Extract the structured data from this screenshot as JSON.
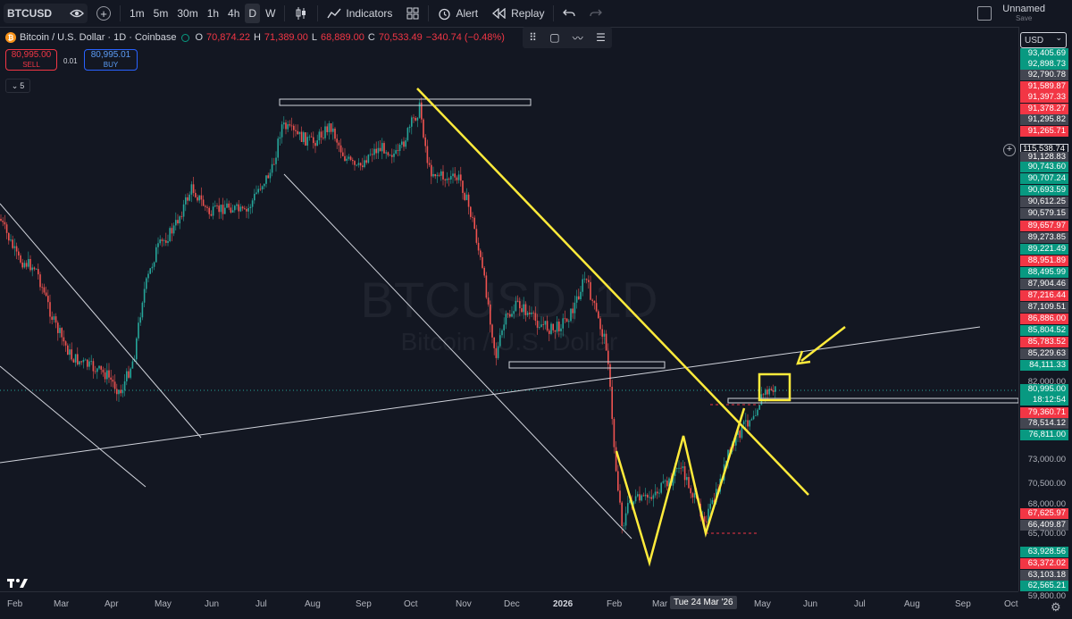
{
  "toolbar": {
    "symbol": "BTCUSD",
    "timeframes": [
      "1m",
      "5m",
      "30m",
      "1h",
      "4h",
      "D",
      "W"
    ],
    "active_timeframe": "D",
    "indicators_label": "Indicators",
    "alert_label": "Alert",
    "replay_label": "Replay",
    "layout_name": "Unnamed",
    "layout_status": "Save"
  },
  "legend": {
    "coin_symbol": "₿",
    "title": "Bitcoin / U.S. Dollar · 1D · Coinbase",
    "o_label": "O",
    "o_value": "70,874.22",
    "h_label": "H",
    "h_value": "71,389.00",
    "l_label": "L",
    "l_value": "68,889.00",
    "c_label": "C",
    "c_value": "70,533.49",
    "change": "−340.74 (−0.48%)"
  },
  "trade": {
    "sell_price": "80,995.00",
    "sell_label": "SELL",
    "spread": "0.01",
    "buy_price": "80,995.01",
    "buy_label": "BUY"
  },
  "indicator_count": "5",
  "watermark": {
    "symbol": "BTCUSD, 1D",
    "name": "Bitcoin / U.S. Dollar"
  },
  "price_axis": {
    "currency": "USD",
    "labels": [
      {
        "text": "93,405.69",
        "style": "green"
      },
      {
        "text": "92,898.73",
        "style": "green"
      },
      {
        "text": "92,790.78",
        "style": "gray"
      },
      {
        "text": "91,589.87",
        "style": "red"
      },
      {
        "text": "91,397.33",
        "style": "red"
      },
      {
        "text": "91,378.27",
        "style": "red"
      },
      {
        "text": "91,295.82",
        "style": "gray"
      },
      {
        "text": "91,265.71",
        "style": "red"
      },
      {
        "text": "115,538.74",
        "style": "dark"
      },
      {
        "text": "91,128.83",
        "style": "gray"
      },
      {
        "text": "90,743.60",
        "style": "green"
      },
      {
        "text": "90,707.24",
        "style": "green"
      },
      {
        "text": "90,693.59",
        "style": "green"
      },
      {
        "text": "90,612.25",
        "style": "gray"
      },
      {
        "text": "90,579.15",
        "style": "gray"
      },
      {
        "text": "89,657.97",
        "style": "red"
      },
      {
        "text": "89,273.85",
        "style": "gray"
      },
      {
        "text": "89,221.49",
        "style": "green"
      },
      {
        "text": "88,951.89",
        "style": "red"
      },
      {
        "text": "88,495.99",
        "style": "green"
      },
      {
        "text": "87,904.46",
        "style": "gray"
      },
      {
        "text": "87,216.44",
        "style": "red"
      },
      {
        "text": "87,109.51",
        "style": "gray"
      },
      {
        "text": "86,886.00",
        "style": "red"
      },
      {
        "text": "85,804.52",
        "style": "green"
      },
      {
        "text": "85,783.52",
        "style": "red"
      },
      {
        "text": "85,229.63",
        "style": "gray"
      },
      {
        "text": "84,111.33",
        "style": "green"
      },
      {
        "text": "82,000.00",
        "style": "plain"
      },
      {
        "text": "80,995.00",
        "style": "green"
      },
      {
        "text": "18:12:54",
        "style": "green"
      },
      {
        "text": "79,360.71",
        "style": "red"
      },
      {
        "text": "78,514.12",
        "style": "gray"
      },
      {
        "text": "76,811.00",
        "style": "green"
      },
      {
        "text": "73,000.00",
        "style": "plain"
      },
      {
        "text": "70,500.00",
        "style": "plain"
      },
      {
        "text": "68,000.00",
        "style": "plain"
      },
      {
        "text": "67,625.97",
        "style": "red"
      },
      {
        "text": "66,409.87",
        "style": "gray"
      },
      {
        "text": "65,700.00",
        "style": "plain"
      },
      {
        "text": "63,928.56",
        "style": "green"
      },
      {
        "text": "63,372.02",
        "style": "red"
      },
      {
        "text": "63,103.18",
        "style": "gray"
      },
      {
        "text": "62,565.21",
        "style": "green"
      },
      {
        "text": "59,800.00",
        "style": "plain"
      }
    ]
  },
  "time_axis": {
    "labels": [
      "Feb",
      "Mar",
      "Apr",
      "May",
      "Jun",
      "Jul",
      "Aug",
      "Sep",
      "Oct",
      "Nov",
      "Dec",
      "2026",
      "Feb",
      "Mar",
      "May",
      "Jun",
      "Jul",
      "Aug",
      "Sep",
      "Oct"
    ],
    "cursor_date": "Tue 24 Mar '26"
  },
  "colors": {
    "background": "#131722",
    "up": "#26a69a",
    "down": "#ef5350",
    "annotation": "#ffeb3b",
    "green_label": "#089981",
    "red_label": "#f23645",
    "gray_label": "#434651"
  }
}
